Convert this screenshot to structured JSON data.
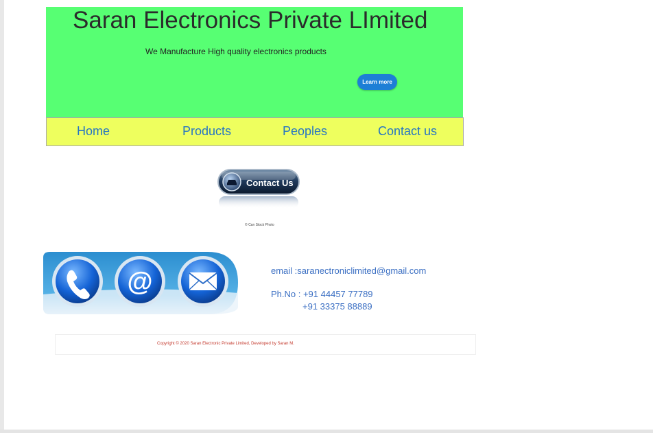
{
  "header": {
    "title": "Saran Electronics Private LImited",
    "tagline": "We Manufacture High quality electronics  products",
    "learn_more_label": "Learn more"
  },
  "nav": {
    "items": [
      {
        "label": "Home"
      },
      {
        "label": "Products"
      },
      {
        "label": "Peoples"
      },
      {
        "label": "Contact us"
      }
    ]
  },
  "contact_image": {
    "label": "Contact Us",
    "credit": "© Can Stock Photo"
  },
  "contact": {
    "email_line": "email :saranectroniclimited@gmail.com",
    "phone_line1": "Ph.No : +91 44457 77789",
    "phone_line2": "+91 33375 88889"
  },
  "footer": {
    "text": "Copyright © 2020 Saran Electronic Private Limited, Developed by Saran M."
  },
  "colors": {
    "banner_bg": "#57ff73",
    "nav_bg": "#eeff5e",
    "nav_text": "#2574c4",
    "button_bg": "#1d7fd6",
    "contact_text": "#3b6fc3",
    "footer_text": "#c43a2e"
  }
}
